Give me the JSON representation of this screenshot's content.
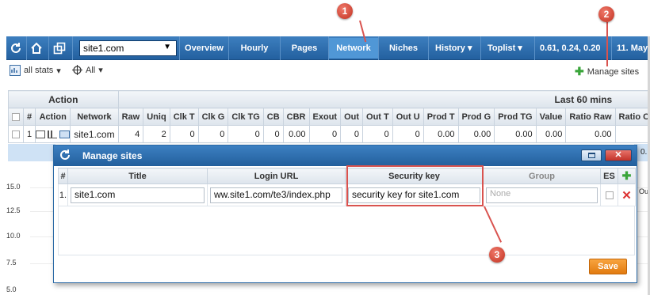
{
  "topbar": {
    "site_selected": "site1.com",
    "nav": [
      "Overview",
      "Hourly",
      "Pages",
      "Network",
      "Niches",
      "History",
      "Toplist"
    ],
    "active_nav": "Network",
    "load": "0.61, 0.24, 0.20",
    "date": "11. May,"
  },
  "subbar": {
    "stats_label": "all stats",
    "filter_label": "All",
    "manage_sites": "Manage sites"
  },
  "main_table": {
    "group_action": "Action",
    "group_last": "Last 60 mins",
    "columns": [
      "#",
      "Action",
      "Network",
      "Raw",
      "Uniq",
      "Clk T",
      "Clk G",
      "Clk TG",
      "CB",
      "CBR",
      "Exout",
      "Out",
      "Out T",
      "Out U",
      "Prod T",
      "Prod G",
      "Prod TG",
      "Value",
      "Ratio Raw",
      "Ratio Clk"
    ],
    "row": {
      "index": "1",
      "network": "site1.com",
      "cells": [
        "4",
        "2",
        "0",
        "0",
        "0",
        "0",
        "0.00",
        "0",
        "0",
        "0",
        "0",
        "0.00",
        "0.00",
        "0.00",
        "0.00",
        "0.00",
        "0."
      ]
    }
  },
  "chart_bg": {
    "y_ticks": [
      "15.0",
      "12.5",
      "10.0",
      "7.5",
      "5.0"
    ],
    "right_label": "Out",
    "partial_value": "0."
  },
  "dialog": {
    "title": "Manage sites",
    "columns": [
      "#",
      "Title",
      "Login URL",
      "Security key",
      "Group",
      "ES"
    ],
    "row": {
      "index": "1.",
      "title": "site1.com",
      "login_url": "ww.site1.com/te3/index.php",
      "security_key": "security key for site1.com",
      "group_placeholder": "None"
    },
    "save_label": "Save"
  },
  "annotations": [
    "1",
    "2",
    "3"
  ],
  "colors": {
    "nav_bar": "#23609f",
    "nav_active": "#5097d6",
    "highlight": "#d9534f",
    "save_button": "#e27b10"
  }
}
